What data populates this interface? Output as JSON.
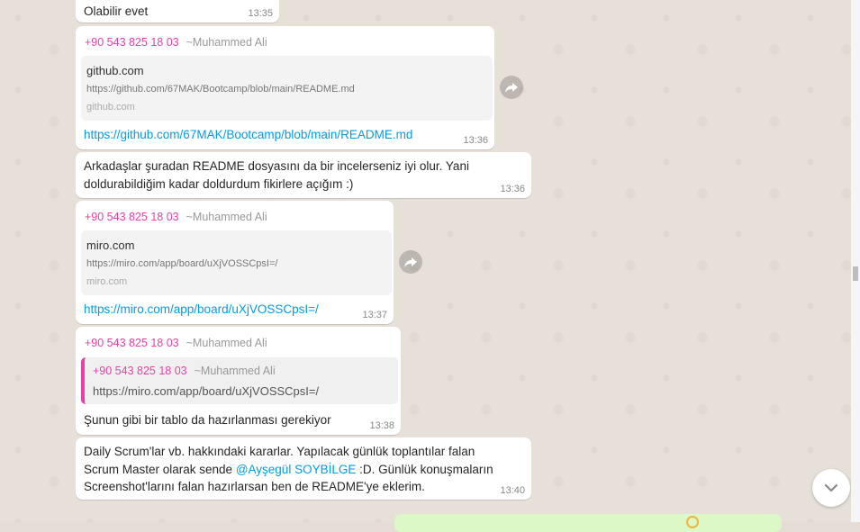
{
  "messages": [
    {
      "text": "Olabilir evet",
      "time": "13:35"
    },
    {
      "sender_phone": "+90 543 825 18 03",
      "sender_name": "~Muhammed Ali",
      "preview": {
        "domain": "github.com",
        "url": "https://github.com/67MAK/Bootcamp/blob/main/README.md",
        "host": "github.com"
      },
      "link": "https://github.com/67MAK/Bootcamp/blob/main/README.md",
      "time": "13:36"
    },
    {
      "line1": "Arkadaşlar şuradan README dosyasını da bir incelerseniz iyi olur. Yani",
      "line2": "doldurabildiğim kadar doldurdum fikirlere açığım :)",
      "time": "13:36"
    },
    {
      "sender_phone": "+90 543 825 18 03",
      "sender_name": "~Muhammed Ali",
      "preview": {
        "domain": "miro.com",
        "url": "https://miro.com/app/board/uXjVOSSCpsI=/",
        "host": "miro.com"
      },
      "link": "https://miro.com/app/board/uXjVOSSCpsI=/",
      "time": "13:37"
    },
    {
      "sender_phone": "+90 543 825 18 03",
      "sender_name": "~Muhammed Ali",
      "quote": {
        "sender_phone": "+90 543 825 18 03",
        "sender_name": "~Muhammed Ali",
        "text": "https://miro.com/app/board/uXjVOSSCpsI=/"
      },
      "text": "Şunun gibi bir tablo da hazırlanması gerekiyor",
      "time": "13:38"
    },
    {
      "line1": "Daily Scrum'lar vb. hakkındaki kararlar. Yapılacak günlük toplantılar falan",
      "line2_before": "Scrum Master olarak sende ",
      "mention": "@Ayşegül SOYBİLGE",
      "line2_after": " :D. Günlük konuşmaların",
      "line3": "Screenshot'larını falan hazırlarsan ben de README'ye eklerim.",
      "time": "13:40"
    }
  ],
  "icons": {
    "forward": "forward-arrow-icon",
    "scroll_down": "chevron-down-icon"
  },
  "colors": {
    "sender": "#e542a3",
    "link": "#039be5",
    "outgoing_bubble": "#dcf8c6"
  }
}
